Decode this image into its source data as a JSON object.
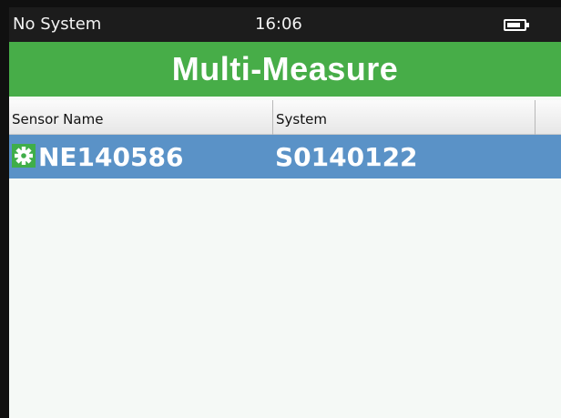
{
  "status_bar": {
    "system_label": "No System",
    "time": "16:06",
    "battery_level": 0.85,
    "battery_icon": "battery-icon"
  },
  "header": {
    "title": "Multi-Measure",
    "accent_color": "#47ad48"
  },
  "table": {
    "columns": [
      "Sensor Name",
      "System"
    ],
    "rows": [
      {
        "sensor_name": "NE140586",
        "system": "S0140122",
        "status_icon": "gear-icon"
      }
    ],
    "selected_row_color": "#5a92c7"
  }
}
